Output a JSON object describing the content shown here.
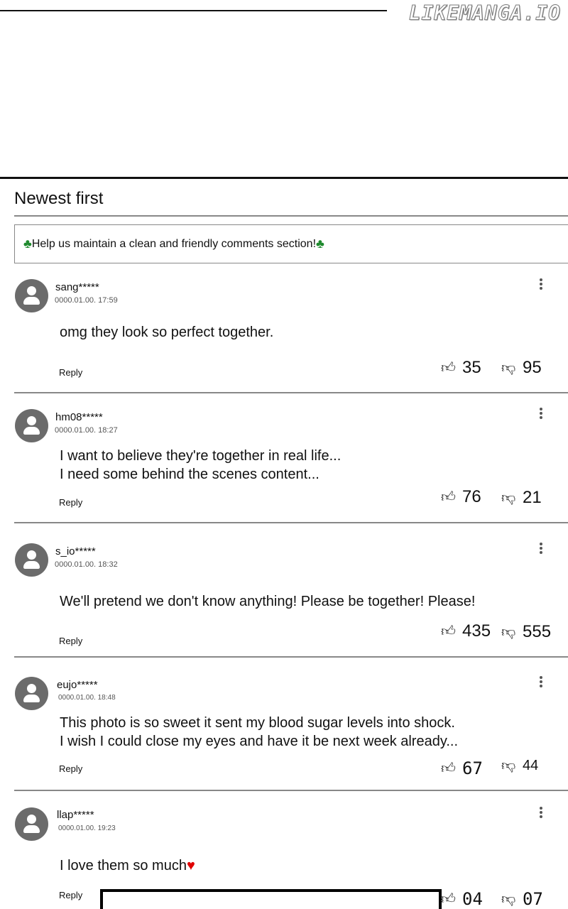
{
  "watermark": "LIKEMANGA.IO",
  "sort": {
    "label": "Newest first"
  },
  "notice": {
    "text": "Help us maintain a clean and friendly comments section!",
    "icon": "club-icon",
    "color": "#1f8a2e"
  },
  "reply_label": "Reply",
  "comments": [
    {
      "user": "sang*****",
      "time": "0000.01.00. 17:59",
      "text": "omg they look so perfect together.",
      "likes": "35",
      "dislikes": "95"
    },
    {
      "user": "hm08*****",
      "time": "0000.01.00. 18:27",
      "text": "I want to believe they're together in real life...\nI need some behind the scenes content...",
      "likes": "76",
      "dislikes": "21"
    },
    {
      "user": "s_io*****",
      "time": "0000.01.00. 18:32",
      "text": "We'll pretend we don't know anything! Please be together! Please!",
      "likes": "435",
      "dislikes": "555"
    },
    {
      "user": "eujo*****",
      "time": "0000.01.00. 18:48",
      "text": "This photo is so sweet it sent my blood sugar levels into shock.\nI wish I could close my eyes and have it be next week already...",
      "likes": "67",
      "dislikes": "44"
    },
    {
      "user": "llap*****",
      "time": "0000.01.00. 19:23",
      "text": "I love them so much",
      "likes": "04",
      "dislikes": "07"
    }
  ],
  "heart_color": "#e00000"
}
